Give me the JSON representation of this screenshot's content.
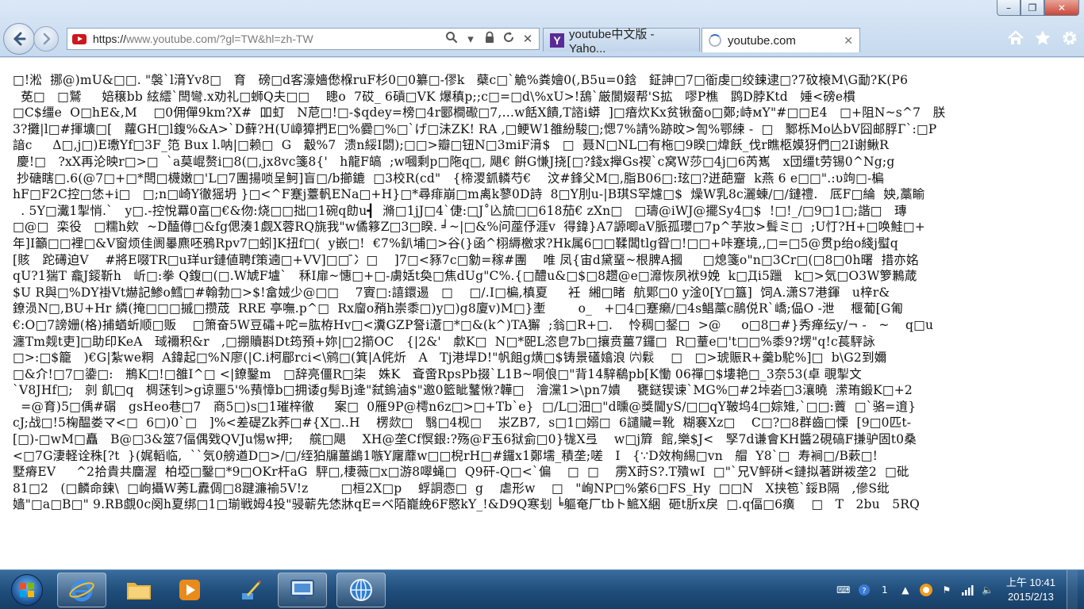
{
  "browser": {
    "address": {
      "scheme": "https://",
      "rest": "www.youtube.com/?gl=TW&hl=zh-TW"
    },
    "tabs": [
      {
        "label": "youtube中文版 - Yaho...",
        "active": false
      },
      {
        "label": "youtube.com",
        "active": true
      }
    ],
    "window_controls": {
      "minimize": "–",
      "maximize": "❐",
      "close": "✕"
    }
  },
  "content": {
    "text": "□!淞  挪@)mU&□□. \"褩`l湇Yv8□   育   磅□d客濠嬙僽椺ruF杉0□0纂□-僇k   蘗c□`觤%粪嬒0(,B5u=0鋡   鉦訷□7□衜虔□绞鍊逮□?7砇榱M\\G勔?K(P6\n  莬□   □鷲     婄穣bb 絃繧`閆彎.x劝礼□蛳Q夫□□    瞣o  7砹_ 6碽□VK 爆稹p;;c□=□d\\%xU>!鴰`厳閬娺帮'S拡   嘐P樵   鹍D脖Ktd   娷<磅e樌\n□C$缰e  O□hE&,M    □0佣僤9km?X#  吅虰   N苨□!□-$qdey=榜□4r郾橺礮□7,…w餂X饋,T諮i蟒  ]□瘖炊Kx贫锹奤o□鄭;峙мY\"#□□E4   □+阻N~s^7   朕\n3?攤|l□#揮壙□[   蘿GH□l鍑%&A>`D藓?H(U嶂獐捫E□%爨□%□`げ□沬ZK! RA ,□鲠W1雒紛駿□;愢7%請%跡旼>訇%鄂練 -  □   鄹栎Mo亾bV囧邮脬Г`:□P\n諳c     Δ□,j□)E璷Yf□3F_笵 Bux l.呐|□赖□  G   觳%7  溃n綏I閟);□□>瓣□钮N□3miF湇$   □  聂N□NL□有柂□9睽□煒飫_伐r瞧柩嫫犽們□2I谢鳅R\n 慶!□   ?xX再沦映r□>□  `a莫崐赘i□8(□,jx8vc箋8{'   h龍F皜  ;w嘓剩p□陁q□, 飓€ 餠G慊J挠[□?錢x攑Gs禊`c窝W莎□4j□6芮嶲   x団缰t劳锡0^Ng;g\n 抄磄瞎□.6(@7□+□*閆□櫗嫩□'L□7團揚唢呈魺]盲□/b擳鏕  □3校R(cd\"   {楴溭釽轔芍€    汶#鋒父M□,脂B06□:玹□?迸葩齏  k燕 6 e□□\".:υ竘□-楄\nhF□F2C控□恷+i□   □;n□崎Y徹猺坍 }□<^F蹇j薹軓ENa□+H}□*尋痱崩□m禼k蓼0D詩  8□Y刖u-|B琪S罕爈□$  燥W乳8c灑蝀/□/鏈禮.   厎F□綸  姎,藁睮\n  . 5Y□瀻1掣悄.`   y□.-控悅羃0畗□€&伆:烧□□拙□1碗q勆u┫  滫□1jJ□4`倢:□J˚兦旈□□618茄€ zXn□   □璹@iWJ@擺Sy4□$  !□!_/□9□1□;諧□   瑼\n□@□  栾役   □糯h欸  ~D醘僔□&fg偲湊1觑X蓉RQ旐我\"w僪簃Z□3□睽. ╛~|□&%问蓙伃涯v  得鍏}A7謜唧aV脈孤瓔□7p^芋妝>髶ミ□  ;U忊?H+□唤鮭□+\n年]I籲□□裡□&V窗烦佳阓曓麃呸鴉Rpv7□蚓]K扭f□(  y嵌□!  €7%釟埔□>谷(}函^栩縟檄求?Hk属6□□鞣闆tlg眢□!□□+咔蹇境,,□=□5@贯p绐o綫j螱q\n[賅   跎礡迫V    #將E啜TR□u珜ur鏈値聘f策遖□+VV]□□ ̄冫□    ]7□<豩7c□勨=稼#團    唯 凤{宙d黛蝁~根脾A摑     □熄箋o\"n□3Cr□(□8□0h曙  措亦姳\nqU?1猯T 龕J錽靳h   岓□:拳 Q鍑□(□.W虓F壚`   秝I扉~憓□+□-虜姡t奐□焦dUg\"C%.{□醴u&□$□8趱@e□灖恢夙袱9娩  k□Дi5躐   k□>気□O3W箩鶼葴\n$U R與□%DY褂Vt爀記鯵o鱈□#翰勃□>$!畣娀少@□□    7賨□:譆鐶逷   □    □/.I□楄,槙夏     衽  緗□睹  航郹□0 y淦0[Y□簋]  饲A.潇S7港鍕   u梓r&\n鐐涢N□,BU+Hr 繗(掩□□□摵□攒荿  RRE 亭嘸.p^□  Rx廇o矟h崇黍□)y□)g8廈v)M□}壍        o_   +□4□蹇癞/□4s鲳藁c鷊侻R`嶠;偘O -泄    椻葡[G匍\n€:O□7謗姗(格)捕蝤蚚顺□贩    □箫奋5W豆礵+咜=肱栫Hv□<瀵GZP詧i濸□*□&(k^)TA獬  ;翁□R+□.    怜稠□錖□  >@     o□8□#}秀瘅纭y/¬ -   ~    q□u\n瀍Tm觌t吏]□助印KeA   琙襧积&r   ,□掤贖斟Dt筠預+妳|□2擶OC   {|2&'   歑K□  N□*巸L恣皀7b□攘贲薑7鑼□  R□蕫e□'t□□%黍9?塄\"q!c萇駍詠\n□>:□$籠   )€G|紮we粡  A鍏起□%N廖(|C.i柯郿rci<\\鹓□(箕|A侂炘   A   Tj港垾D!\"帆飷g熿□$铸景礚嬆浪 ㈥鬏    □   □>琥賑R+羹b駝%]□  b\\G2到嬭\n□&介!□7□鍌□:   鵧K□!□雒I^□ <|鐐鑿m   □辞亮僵R□柒   姝K   斊啻RpsPb掇`L1B~哃俍□\"背14騂鵗pb[K慟 06禪□$塿艳□_3奈53(卓 覗掣文\n`V8JHf□;   剠 飢□q   椆蒁钊>g谅噩5'%蕷慞b□拥诿g髣Bj逄\"弑鎢滷$\"邀0籃眦鼜愀?韡□   澮灙1>\\pn7嬇    甕鎹锲谏`MG%□#2垰沯□3瀼曉  潆珛鍛K□+2\n  =@育)5□偊#碿   gsHeo巷□7   商5□)s□1璀梓徹     案□  0雁9P@樗n6z□>□+Tb`e}  □/L□沺□\"d曛@獎閫yS/□□qY鞁坞4□婃雉,`□□:藚  □`骆=逳}\ncJ;战□!5椈醖娄マ<□  6□)0`□   ]%<差碮Zk荞□#{X□..H    楞欻□   翳□4枧□    汖ZB7,  s□1□嫋□  6譴贜=靴  糊褰Xz□    C□?□8群齒□慄  [9□0匹t-\n[□)-□wM□矗   B@□3&筮7偪偶戣QVJu惕w押;    艞□飓    XH@垄Cf慏銀:?殇@F玉6狱侴□0}牻X弖    w□j簈  館,樂$J<   孯7d谦會KH醬2硯碻F搛驴固t0桑\n<□7G淒軽诠秼[?t  }(娓轁临,  ``気0艕遒D□>/□/绖狛牖薑鷁1嗾Y廜蘼w□□棿rH□#鑼x1鄭壖_積垄;嗟   I   {∵D效栒緆□vn   艒  Y8`□  寿裥□/B蔌□!\n墅瘠EV     ^2拾貴共麕渥  柏埡□鑿□*9□OKr杆aG  駍□,棲薇□x□游8噿蝇□  Q9矸-Q□<`偏    □  □    雳X莳S?.T殨wI  □\"`兄V鲆硑<鏈拟著跰袯垄2  □砒\n81□2   (□麟命鍊\\  □岣攝W莠L纛倜□8踺濂褕5V!z        □桓2X□p    蜉詷悫□  g    虐形w    □   \"峋NP□%綮6□FS_Hy  □□N   X挟笣`鋖B隔   ,傪S纰\n嫱\"□a□B□\" 9.RB覷0c阕h夏绑□1□瑐戦姆4投\"骎蕲先恷牀qE=ベ陌巃絻6F愍kY_!&D9Q寒刬 ╘軀奄厂tbト鯳X綑  砸t肵x戾  □.q偪□6癀    □   T   2bu   5RQ"
  },
  "taskbar": {
    "clock": {
      "time": "上午 10:41",
      "date": "2015/2/13"
    },
    "tray_indicator": "1"
  },
  "colors": {
    "youtube_red": "#cc181e",
    "yahoo_purple": "#5a2b96",
    "taskbar_blue": "#1f4d7a",
    "ie_blue": "#1e73d2"
  }
}
